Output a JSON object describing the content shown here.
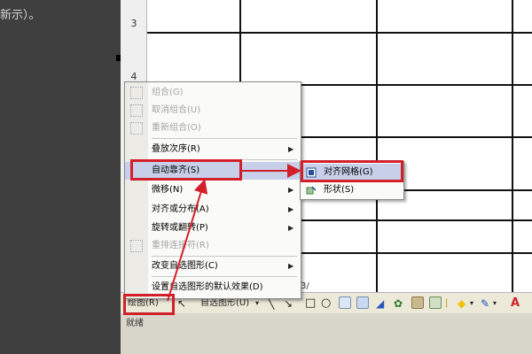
{
  "background": {
    "snippet": "新示）。"
  },
  "sheet": {
    "row_numbers": [
      "3",
      "4"
    ],
    "sheet_tab": "3/"
  },
  "menu": {
    "items": [
      {
        "label": "组合(G)",
        "disabled": true,
        "submenu": false
      },
      {
        "label": "取消组合(U)",
        "disabled": true,
        "submenu": false
      },
      {
        "label": "重新组合(O)",
        "disabled": true,
        "submenu": false
      },
      {
        "label": "叠放次序(R)",
        "disabled": false,
        "submenu": true
      },
      {
        "label": "自动靠齐(S)",
        "disabled": false,
        "submenu": true,
        "highlighted": true
      },
      {
        "label": "微移(N)",
        "disabled": false,
        "submenu": true
      },
      {
        "label": "对齐或分布(A)",
        "disabled": false,
        "submenu": true
      },
      {
        "label": "旋转或翻转(P)",
        "disabled": false,
        "submenu": true
      },
      {
        "label": "重排连接符(R)",
        "disabled": true,
        "submenu": false
      },
      {
        "label": "改变自选图形(C)",
        "disabled": false,
        "submenu": true
      },
      {
        "label": "设置自选图形的默认效果(D)",
        "disabled": false,
        "submenu": false
      }
    ]
  },
  "submenu": {
    "items": [
      {
        "label": "对齐网格(G)"
      },
      {
        "label": "形状(S)"
      }
    ]
  },
  "toolbar": {
    "draw_label": "绘图(R)",
    "autoshapes_label": "自选图形(U)"
  },
  "status": {
    "text": "就绪"
  },
  "colors": {
    "annotation": "#d2202a",
    "highlight": "#c7d0e8",
    "toolbar": "#ece9d8"
  }
}
